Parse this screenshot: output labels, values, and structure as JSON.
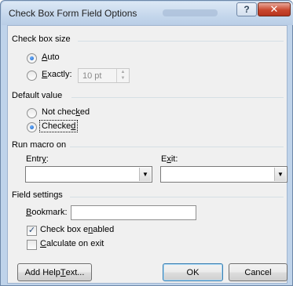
{
  "window": {
    "title": "Check Box Form Field Options",
    "help_glyph": "?",
    "close_glyph": "✕"
  },
  "check_box_size": {
    "heading": "Check box size",
    "auto_label": "Auto",
    "exactly_label": "Exactly:",
    "exactly_value": "10 pt",
    "selected": "Auto"
  },
  "default_value": {
    "heading": "Default value",
    "not_checked_label": "Not checked",
    "checked_label": "Checked",
    "selected": "Checked"
  },
  "run_macro": {
    "heading": "Run macro on",
    "entry_label": "Entry:",
    "exit_label": "Exit:",
    "entry_value": "",
    "exit_value": ""
  },
  "field_settings": {
    "heading": "Field settings",
    "bookmark_label": "Bookmark:",
    "bookmark_value": "",
    "check_box_enabled_label": "Check box enabled",
    "check_box_enabled": true,
    "calculate_on_exit_label": "Calculate on exit",
    "calculate_on_exit": false
  },
  "buttons": {
    "add_help_text": "Add Help Text...",
    "ok": "OK",
    "cancel": "Cancel"
  },
  "icons": {
    "dropdown": "▼",
    "checkmark": "✓",
    "spin_up": "▲",
    "spin_down": "▼"
  },
  "colors": {
    "title_bar": "#c5d7ec",
    "close_button": "#c9472e",
    "dialog_background": "#f0f0f0",
    "radio_dot": "#1a5fc0"
  }
}
